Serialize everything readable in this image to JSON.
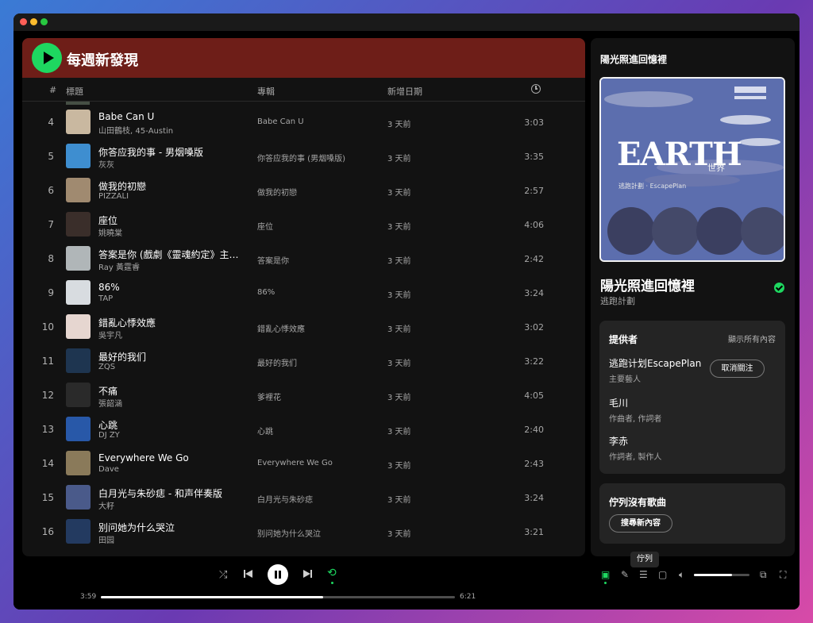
{
  "playlist": {
    "title": "每週新發現",
    "columns": {
      "num": "#",
      "title": "標題",
      "album": "專輯",
      "date": "新增日期"
    },
    "tracks": [
      {
        "num": "4",
        "title": "Babe Can U",
        "artist": "山田鶴枝, 45-Austin",
        "album": "Babe Can U",
        "date": "3 天前",
        "duration": "3:03",
        "art_color": "#c9b8a0"
      },
      {
        "num": "5",
        "title": "你答应我的事 - 男烟嗓版",
        "artist": "灰灰",
        "album": "你答应我的事 (男烟嗓版)",
        "date": "3 天前",
        "duration": "3:35",
        "art_color": "#3e8ed0"
      },
      {
        "num": "6",
        "title": "做我的初戀",
        "artist": "PIZZALI",
        "album": "做我的初戀",
        "date": "3 天前",
        "duration": "2:57",
        "art_color": "#a08a70"
      },
      {
        "num": "7",
        "title": "座位",
        "artist": "姚曉棠",
        "album": "座位",
        "date": "3 天前",
        "duration": "4:06",
        "art_color": "#3a2e2a"
      },
      {
        "num": "8",
        "title": "答案是你 (戲劇《靈魂約定》主…",
        "artist": "Ray 黃霆睿",
        "album": "答案是你",
        "date": "3 天前",
        "duration": "2:42",
        "art_color": "#b0b6b8"
      },
      {
        "num": "9",
        "title": "86%",
        "artist": "TAP",
        "album": "86%",
        "date": "3 天前",
        "duration": "3:24",
        "art_color": "#d8dce0"
      },
      {
        "num": "10",
        "title": "錯亂心悸效應",
        "artist": "吳宇凡",
        "album": "錯亂心悸效應",
        "date": "3 天前",
        "duration": "3:02",
        "art_color": "#e6d6d0"
      },
      {
        "num": "11",
        "title": "最好的我们",
        "artist": "ZQS",
        "album": "最好的我们",
        "date": "3 天前",
        "duration": "3:22",
        "art_color": "#1e3550"
      },
      {
        "num": "12",
        "title": "不痛",
        "artist": "張韶涵",
        "album": "爹裡花",
        "date": "3 天前",
        "duration": "4:05",
        "art_color": "#2a2a2a"
      },
      {
        "num": "13",
        "title": "心跳",
        "artist": "DJ ZY",
        "album": "心跳",
        "date": "3 天前",
        "duration": "2:40",
        "art_color": "#2858a8"
      },
      {
        "num": "14",
        "title": "Everywhere We Go",
        "artist": "Dave",
        "album": "Everywhere We Go",
        "date": "3 天前",
        "duration": "2:43",
        "art_color": "#8a7a5a"
      },
      {
        "num": "15",
        "title": "白月光与朱砂痣 - 和声伴奏版",
        "artist": "大籽",
        "album": "白月光与朱砂痣",
        "date": "3 天前",
        "duration": "3:24",
        "art_color": "#4a5a8a"
      },
      {
        "num": "16",
        "title": "别问她为什么哭泣",
        "artist": "田园",
        "album": "别问她为什么哭泣",
        "date": "3 天前",
        "duration": "3:21",
        "art_color": "#233a60"
      }
    ]
  },
  "side_panel": {
    "header": "陽光照進回憶裡",
    "cover_text": "EARTH",
    "cover_subtext": "世界",
    "cover_caption": "逃跑計劃 · EscapePlan",
    "song_title": "陽光照進回憶裡",
    "song_artist": "逃跑計劃",
    "credits": {
      "title": "提供者",
      "show_all": "顯示所有內容",
      "unfollow_label": "取消關注",
      "people": [
        {
          "name": "逃跑计划EscapePlan",
          "role": "主要藝人"
        },
        {
          "name": "毛川",
          "role": "作曲者, 作詞者"
        },
        {
          "name": "李赤",
          "role": "作詞者, 製作人"
        }
      ]
    },
    "queue": {
      "title": "佇列沒有歌曲",
      "search_label": "搜尋新內容"
    }
  },
  "player": {
    "elapsed": "3:59",
    "total": "6:21",
    "progress_fraction": 0.628,
    "volume_fraction": 0.68,
    "tooltip": "佇列"
  },
  "colors": {
    "accent": "#1ed760",
    "header_band": "#6e1e18"
  }
}
